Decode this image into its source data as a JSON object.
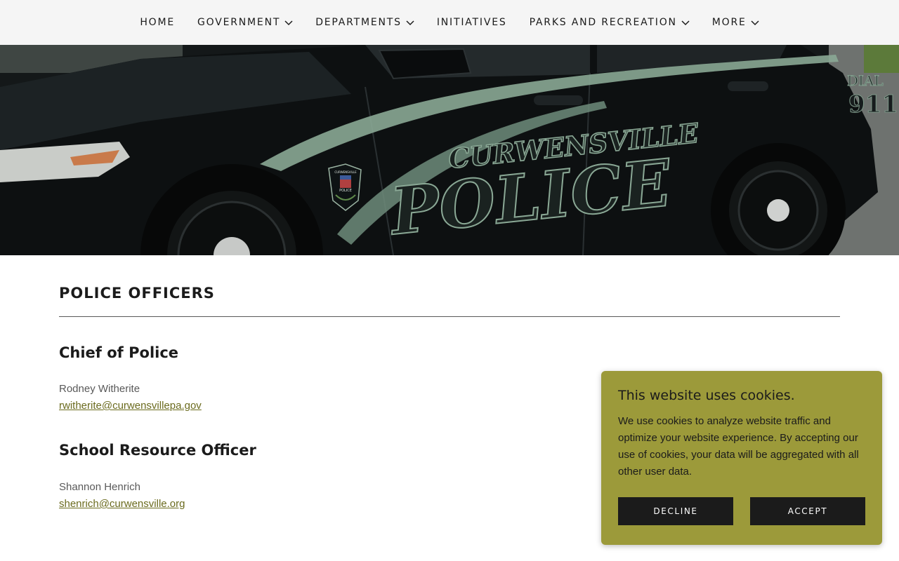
{
  "nav": {
    "items": [
      {
        "label": "HOME",
        "dropdown": false
      },
      {
        "label": "GOVERNMENT",
        "dropdown": true
      },
      {
        "label": "DEPARTMENTS",
        "dropdown": true
      },
      {
        "label": "INITIATIVES",
        "dropdown": false
      },
      {
        "label": "PARKS AND RECREATION",
        "dropdown": true
      },
      {
        "label": "MORE",
        "dropdown": true
      }
    ]
  },
  "hero": {
    "car_text_top": "CURWENSVILLE",
    "car_text_main": "POLICE",
    "dial_text": "DIAL",
    "dial_number": "911",
    "badge_text_top": "CURWENSVILLE",
    "badge_text_bottom": "POLICE"
  },
  "main": {
    "section_title": "POLICE OFFICERS",
    "officers": [
      {
        "role": "Chief of Police",
        "name": "Rodney Witherite",
        "email": "rwitherite@curwensvillepa.gov"
      },
      {
        "role": "School Resource Officer",
        "name": "Shannon Henrich",
        "email": "shenrich@curwensville.org"
      }
    ]
  },
  "cookie": {
    "title": "This website uses cookies.",
    "text": "We use cookies to analyze website traffic and optimize your website experience. By accepting our use of cookies, your data will be aggregated with all other user data.",
    "decline_label": "DECLINE",
    "accept_label": "ACCEPT"
  },
  "colors": {
    "nav_bg": "#f5f5f5",
    "link": "#6b6b1e",
    "cookie_bg": "#9c9a3a",
    "button_bg": "#1b1b1b",
    "police_stripe": "#8aa895"
  }
}
